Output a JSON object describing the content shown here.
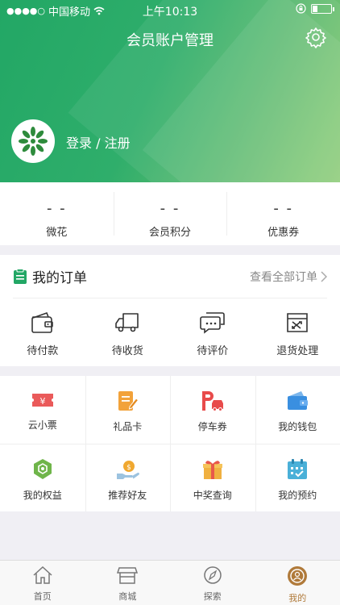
{
  "status_bar": {
    "carrier": "中国移动",
    "time": "上午10:13"
  },
  "header": {
    "title": "会员账户管理",
    "login_text": "登录 / 注册"
  },
  "stats": [
    {
      "value": "- -",
      "label": "微花"
    },
    {
      "value": "- -",
      "label": "会员积分"
    },
    {
      "value": "- -",
      "label": "优惠券"
    }
  ],
  "orders": {
    "title": "我的订单",
    "view_all": "查看全部订单",
    "items": [
      {
        "label": "待付款",
        "icon": "wallet-icon"
      },
      {
        "label": "待收货",
        "icon": "truck-icon"
      },
      {
        "label": "待评价",
        "icon": "comment-icon"
      },
      {
        "label": "退货处理",
        "icon": "return-box-icon"
      }
    ]
  },
  "services": [
    {
      "label": "云小票",
      "icon": "ticket-icon",
      "color": "#ea5a5a"
    },
    {
      "label": "礼品卡",
      "icon": "gift-card-icon",
      "color": "#f2a23a"
    },
    {
      "label": "停车券",
      "icon": "parking-icon",
      "color": "#e84b4b"
    },
    {
      "label": "我的钱包",
      "icon": "wallet-blue-icon",
      "color": "#3a8fe0"
    },
    {
      "label": "我的权益",
      "icon": "badge-icon",
      "color": "#6fb54a"
    },
    {
      "label": "推荐好友",
      "icon": "recommend-icon",
      "color": "#f0a830"
    },
    {
      "label": "中奖查询",
      "icon": "prize-icon",
      "color": "#f0b040"
    },
    {
      "label": "我的预约",
      "icon": "calendar-icon",
      "color": "#4ab0d8"
    }
  ],
  "tabbar": [
    {
      "label": "首页",
      "icon": "home-icon"
    },
    {
      "label": "商城",
      "icon": "store-icon"
    },
    {
      "label": "探索",
      "icon": "compass-icon"
    },
    {
      "label": "我的",
      "icon": "profile-icon",
      "active": true
    }
  ],
  "colors": {
    "brand_green": "#22a765",
    "active_tab": "#b07a3a"
  }
}
